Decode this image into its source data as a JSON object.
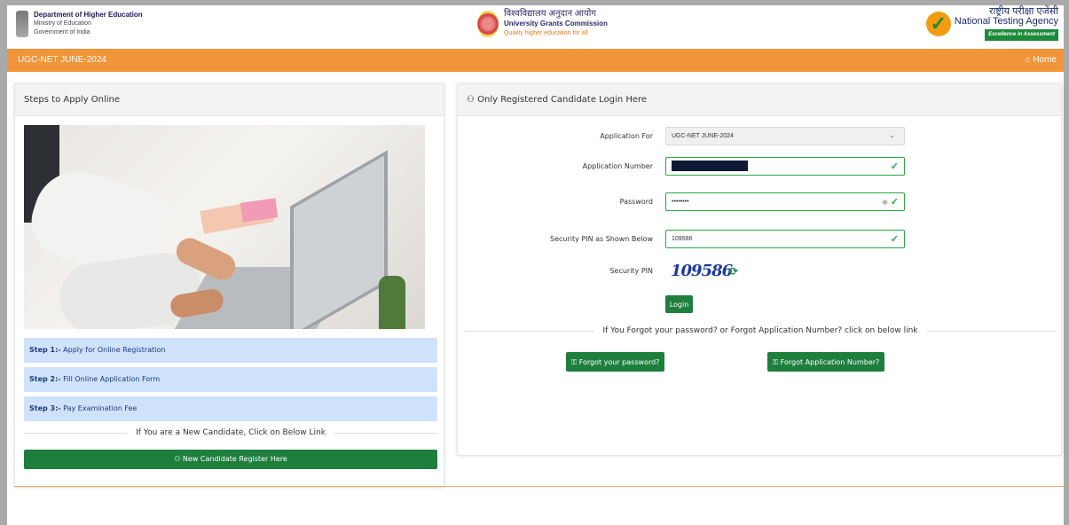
{
  "header": {
    "dhe": {
      "title": "Department of Higher Education",
      "line1": "Ministry of Education",
      "line2": "Government of India"
    },
    "ugc": {
      "hindi": "विश्वविद्यालय अनुदान आयोग",
      "english": "University Grants Commission",
      "tagline": "Quality higher education for all"
    },
    "nta": {
      "hindi": "राष्ट्रीय परीक्षा एजेंसी",
      "english": "National Testing Agency",
      "tagline": "Excellence in Assessment"
    }
  },
  "navbar": {
    "title": "UGC-NET JUNE-2024",
    "home_label": "Home"
  },
  "left_panel": {
    "title": "Steps to Apply Online",
    "steps": [
      {
        "num": "Step 1:-",
        "text": " Apply for Online Registration"
      },
      {
        "num": "Step 2:-",
        "text": " Fill Online Application Form"
      },
      {
        "num": "Step 3:-",
        "text": " Pay Examination Fee"
      }
    ],
    "new_candidate_text": "If You are a New Candidate, Click on Below Link",
    "register_button": "New Candidate Register Here"
  },
  "login_panel": {
    "title": "Only Registered Candidate Login Here",
    "fields": {
      "application_for": {
        "label": "Application For",
        "value": "UGC-NET JUNE-2024"
      },
      "application_number": {
        "label": "Application Number",
        "value": ""
      },
      "password": {
        "label": "Password",
        "value": "••••••••"
      },
      "security_pin_input": {
        "label": "Security PIN as Shown Below",
        "value": "109586"
      },
      "security_pin": {
        "label": "Security PIN",
        "value": "109586"
      }
    },
    "login_button": "Login",
    "forgot_text": "If You Forgot your password? or Forgot Application Number? click on below link",
    "forgot_password_button": "Forgot your password?",
    "forgot_appnum_button": "Forgot Application Number?"
  },
  "colors": {
    "accent_orange": "#f0953a",
    "button_green": "#1e7e3e",
    "step_blue": "#cfe2fb"
  }
}
